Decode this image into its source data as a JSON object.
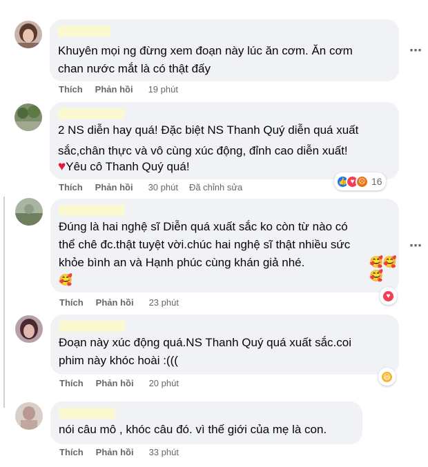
{
  "comments": [
    {
      "text": "Khuyên mọi ng đừng xem đoạn này lúc ăn cơm. Ăn cơm\nchan nước mắt là có thật đấy",
      "like": "Thích",
      "reply": "Phản hồi",
      "time": "19 phút"
    },
    {
      "text_line1": "2 NS diễn hay quá! Đặc biệt NS Thanh Quý diễn quá xuất",
      "text_line2": "sắc,chân thực và vô cùng xúc động, đỉnh cao diễn xuất!",
      "text_line3": " Yêu cô Thanh Quý quá!",
      "like": "Thích",
      "reply": "Phản hồi",
      "time": "30 phút",
      "edited": "Đã chỉnh sửa",
      "reaction_count": "16",
      "reaction_icons": [
        "like-icon",
        "love-icon",
        "angry-icon"
      ]
    },
    {
      "text": "Đúng là hai nghệ sĩ Diễn quá xuất sắc ko còn từ nào có\nthể chê đc.thật tuyệt vời.chúc hai nghệ sĩ thật nhiều sức\nkhỏe bình an và Hạnh phúc cùng khán giả nhé.",
      "like": "Thích",
      "reply": "Phản hồi",
      "time": "23 phút",
      "reaction_icons": [
        "love-icon"
      ]
    },
    {
      "text": "Đoạn này xúc động quá.NS Thanh Quý quá xuất sắc.coi\nphim này khóc hoài :(((",
      "like": "Thích",
      "reply": "Phản hồi",
      "time": "20 phút",
      "reaction_icons": [
        "haha-icon"
      ]
    },
    {
      "text": "nói câu mô , khóc câu đó. vì thế giới của mẹ là con.",
      "like": "Thích",
      "reply": "Phản hồi",
      "time": "33 phút"
    }
  ],
  "colors": {
    "bubble": "#f0f2f5",
    "name_redaction": "#fbf9cf",
    "meta_text": "#65676b",
    "like_blue": "#1877f2",
    "love_red": "#f33e58",
    "angry_orange": "#e9710f",
    "haha_yellow": "#f7b125"
  }
}
